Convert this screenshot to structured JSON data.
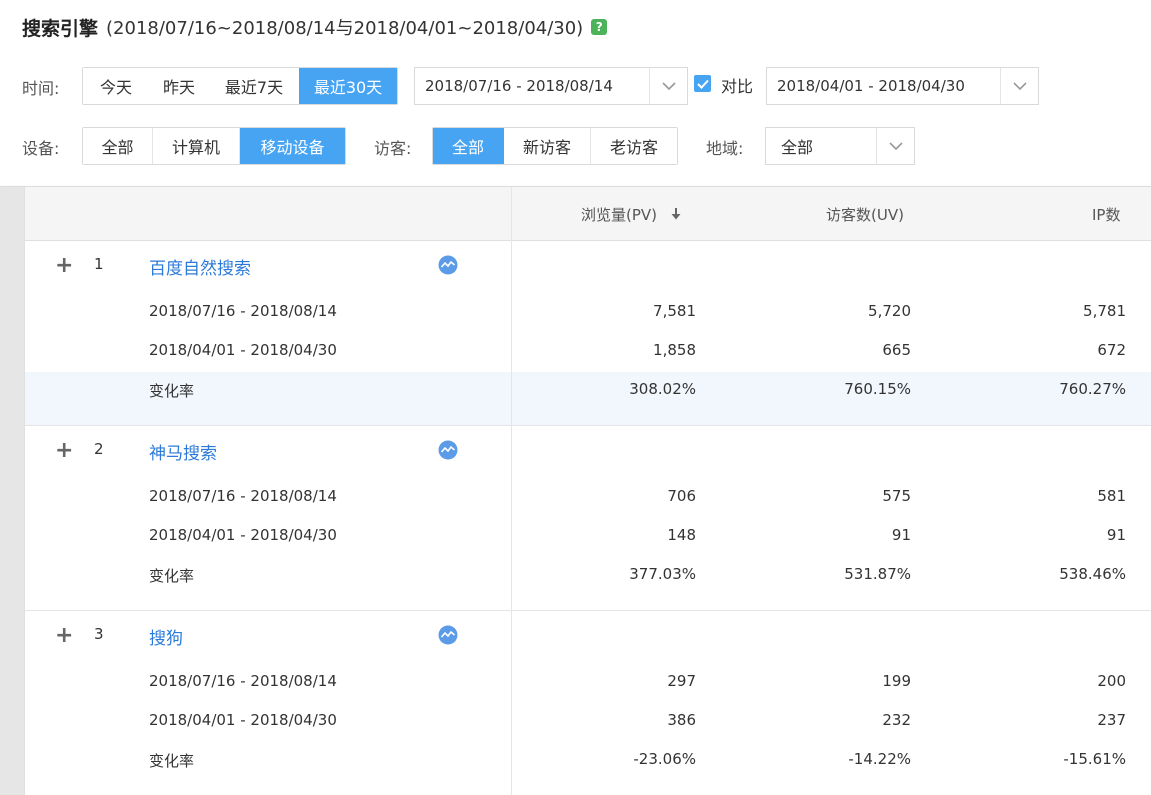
{
  "header": {
    "title": "搜索引擎",
    "subtitle": "(2018/07/16~2018/08/14与2018/04/01~2018/04/30)",
    "help": "?"
  },
  "filters": {
    "time_label": "时间:",
    "time_buttons": [
      "今天",
      "昨天",
      "最近7天",
      "最近30天"
    ],
    "time_active": "最近30天",
    "date_range": "2018/07/16 - 2018/08/14",
    "compare_label": "对比",
    "compare_checked": true,
    "compare_range": "2018/04/01 - 2018/04/30",
    "device_label": "设备:",
    "device_buttons": [
      "全部",
      "计算机",
      "移动设备"
    ],
    "device_active": "移动设备",
    "visitor_label": "访客:",
    "visitor_buttons": [
      "全部",
      "新访客",
      "老访客"
    ],
    "visitor_active": "全部",
    "region_label": "地域:",
    "region_value": "全部"
  },
  "table": {
    "columns": [
      "浏览量(PV)",
      "访客数(UV)",
      "IP数"
    ],
    "sorted_column": "浏览量(PV)",
    "rows": [
      {
        "rank": "1",
        "name": "百度自然搜索",
        "period1_label": "2018/07/16 - 2018/08/14",
        "period1": [
          "7,581",
          "5,720",
          "5,781"
        ],
        "period2_label": "2018/04/01 - 2018/04/30",
        "period2": [
          "1,858",
          "665",
          "672"
        ],
        "change_label": "变化率",
        "change": [
          "308.02%",
          "760.15%",
          "760.27%"
        ]
      },
      {
        "rank": "2",
        "name": "神马搜索",
        "period1_label": "2018/07/16 - 2018/08/14",
        "period1": [
          "706",
          "575",
          "581"
        ],
        "period2_label": "2018/04/01 - 2018/04/30",
        "period2": [
          "148",
          "91",
          "91"
        ],
        "change_label": "变化率",
        "change": [
          "377.03%",
          "531.87%",
          "538.46%"
        ]
      },
      {
        "rank": "3",
        "name": "搜狗",
        "period1_label": "2018/07/16 - 2018/08/14",
        "period1": [
          "297",
          "199",
          "200"
        ],
        "period2_label": "2018/04/01 - 2018/04/30",
        "period2": [
          "386",
          "232",
          "237"
        ],
        "change_label": "变化率",
        "change": [
          "-23.06%",
          "-14.22%",
          "-15.61%"
        ]
      }
    ]
  },
  "colors": {
    "accent": "#47a4f3",
    "link": "#2b7ad9",
    "help": "#4cb35a"
  }
}
